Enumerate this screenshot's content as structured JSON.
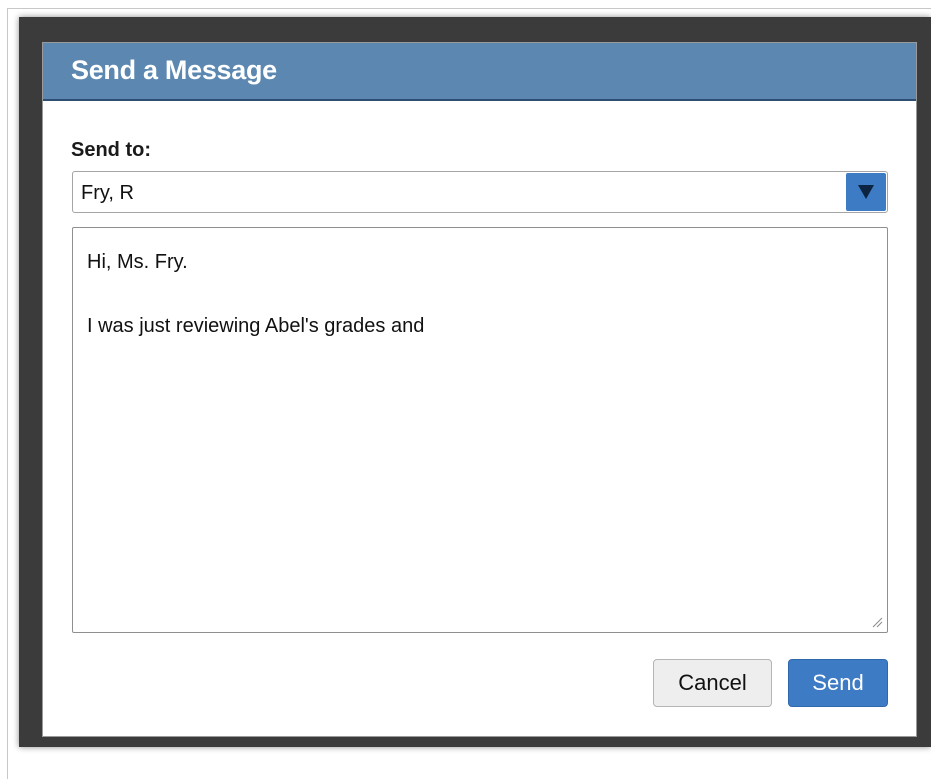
{
  "dialog": {
    "title": "Send a Message",
    "send_to_label": "Send to:",
    "recipient": {
      "selected_value": "Fry, R",
      "dropdown_icon": "triangle-down-icon"
    },
    "message": {
      "lines": [
        "Hi, Ms. Fry.",
        "",
        "I was just reviewing Abel's grades and"
      ]
    },
    "buttons": {
      "cancel_label": "Cancel",
      "send_label": "Send"
    }
  },
  "colors": {
    "header_bg": "#5b87b0",
    "accent_blue": "#3d7bc5",
    "frame_dark": "#3b3b3b"
  }
}
